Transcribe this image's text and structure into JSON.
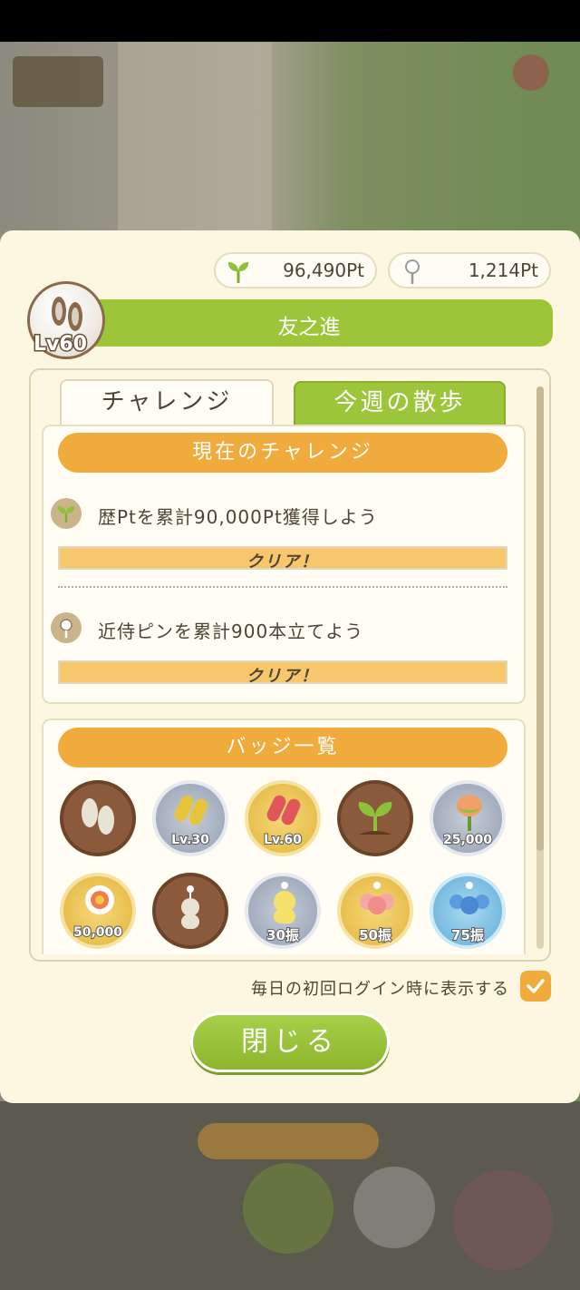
{
  "points": {
    "sprout_pt": "96,490Pt",
    "pin_pt": "1,214Pt"
  },
  "profile": {
    "name": "友之進",
    "level": "Lv60"
  },
  "tabs": [
    {
      "label": "チャレンジ",
      "active": true
    },
    {
      "label": "今週の散歩",
      "active": false
    }
  ],
  "current_challenges": {
    "header": "現在のチャレンジ",
    "items": [
      {
        "icon": "sprout-icon",
        "text": "歴Ptを累計90,000Pt獲得しよう",
        "progress": 1.0,
        "status": "クリア！"
      },
      {
        "icon": "pin-icon",
        "text": "近侍ピンを累計900本立てよう",
        "progress": 1.0,
        "status": "クリア！"
      }
    ]
  },
  "badges": {
    "header": "バッジ一覧",
    "items": [
      {
        "name": "footprints-badge",
        "caption": ""
      },
      {
        "name": "sandals-lv30-badge",
        "caption": "Lv.30"
      },
      {
        "name": "sandals-lv60-badge",
        "caption": "Lv.60"
      },
      {
        "name": "sprout-badge",
        "caption": ""
      },
      {
        "name": "bud-25000-badge",
        "caption": "25,000"
      },
      {
        "name": "flower-50000-badge",
        "caption": "50,000"
      },
      {
        "name": "figure-badge",
        "caption": ""
      },
      {
        "name": "figure-30-badge",
        "caption": "30振"
      },
      {
        "name": "figure-50-badge",
        "caption": "50振"
      },
      {
        "name": "figure-75-badge",
        "caption": "75振"
      }
    ]
  },
  "footer": {
    "show_daily_label": "毎日の初回ログイン時に表示する",
    "show_daily_checked": true,
    "close_label": "閉じる"
  },
  "colors": {
    "accent_green": "#9cc53a",
    "accent_orange": "#f1ab3c",
    "panel_bg": "#fdf7e1"
  }
}
